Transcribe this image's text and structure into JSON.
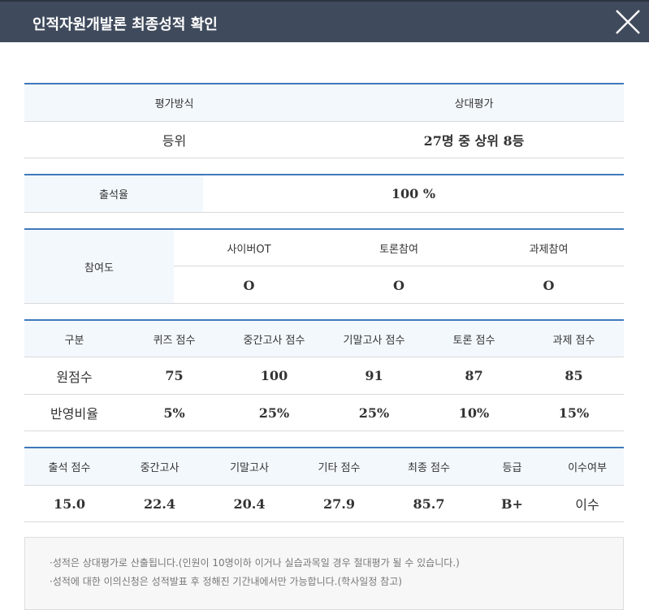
{
  "header": {
    "title": "인적자원개발론 최종성적 확인"
  },
  "evaluation": {
    "method_label": "평가방식",
    "method_value": "상대평가",
    "rank_label": "등위",
    "rank_value": "27명 중 상위 8등"
  },
  "attendance": {
    "label": "출석율",
    "value": "100 %"
  },
  "participation": {
    "label": "참여도",
    "columns": [
      "사이버OT",
      "토론참여",
      "과제참여"
    ],
    "values": [
      "O",
      "O",
      "O"
    ]
  },
  "scores": {
    "headers": [
      "구분",
      "퀴즈 점수",
      "중간고사 점수",
      "기말고사 점수",
      "토론 점수",
      "과제 점수"
    ],
    "raw": {
      "label": "원점수",
      "values": [
        "75",
        "100",
        "91",
        "87",
        "85"
      ]
    },
    "ratio": {
      "label": "반영비율",
      "values": [
        "5%",
        "25%",
        "25%",
        "10%",
        "15%"
      ]
    }
  },
  "final": {
    "headers": [
      "출석 점수",
      "중간고사",
      "기말고사",
      "기타 점수",
      "최종 점수",
      "등급",
      "이수여부"
    ],
    "values": [
      "15.0",
      "22.4",
      "20.4",
      "27.9",
      "85.7",
      "B+",
      "이수"
    ]
  },
  "notice": {
    "lines": [
      "·성적은 상대평가로 산출됩니다.(인원이 10명이하 이거나 실습과목일 경우 절대평가 될 수 있습니다.)",
      "·성적에 대한 이의신청은 성적발표 후 정해진 기간내에서만 가능합니다.(학사일정 참고)"
    ]
  },
  "colors": {
    "header_bg": "#3f4a5c",
    "accent_line": "#3f79bb",
    "label_bg": "#f3f8fd"
  },
  "icons": {
    "close": "close-icon"
  }
}
